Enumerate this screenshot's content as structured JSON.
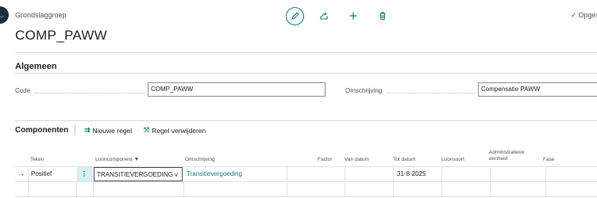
{
  "header": {
    "caption": "Grondslaggroep",
    "title": "COMP_PAWW",
    "saved_status": "Opgeslagen"
  },
  "general": {
    "section_title": "Algemeen",
    "code_label": "Code",
    "code_value": "COMP_PAWW",
    "description_label": "Omschrijving",
    "description_value": "Compensatie PAWW"
  },
  "components": {
    "title": "Componenten",
    "new_line": "Nieuwe regel",
    "delete_line": "Regel verwijderen",
    "columns": {
      "sign": "Teken",
      "pay_component": "Looncomponent",
      "description": "Omschrijving",
      "factor": "Factor",
      "from_date": "Van datum",
      "to_date": "Tot datum",
      "pay_type": "Loonsoort",
      "admin_unit_1": "Administratieve",
      "admin_unit_2": "eenheid",
      "phase": "Fase"
    },
    "rows": [
      {
        "sign": "Positief",
        "pay_component": "TRANSITIEVERGOEDING",
        "description": "Transitievergoeding",
        "factor": "",
        "from_date": "",
        "to_date": "31-8-2025",
        "pay_type": "",
        "admin_unit": "",
        "phase": ""
      }
    ]
  },
  "colors": {
    "accent": "#0f7a7a",
    "selected_cell": "#d5eff5"
  }
}
